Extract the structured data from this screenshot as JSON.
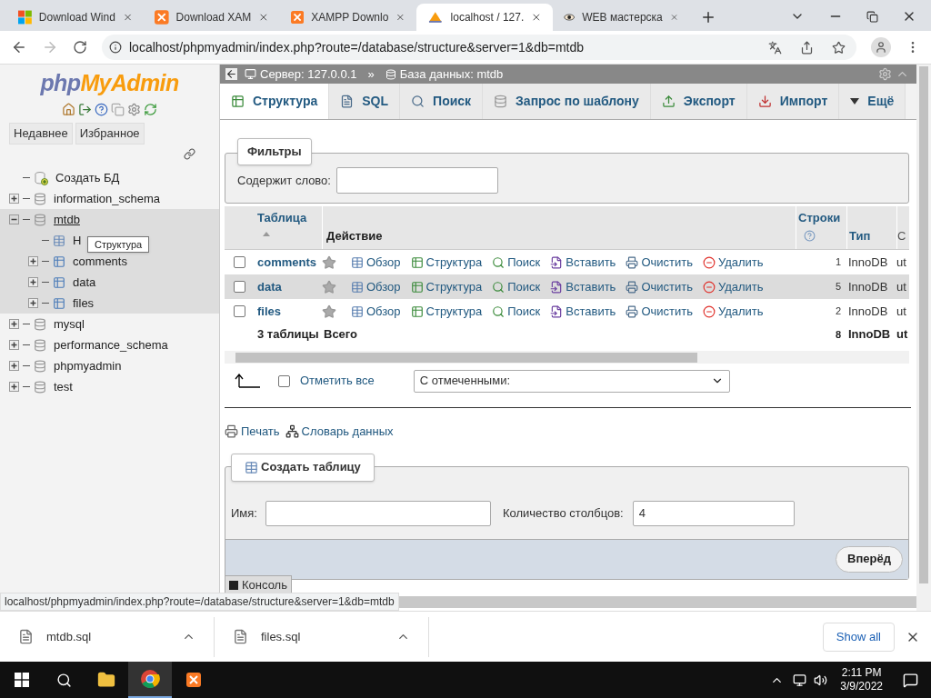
{
  "browser": {
    "tabs": [
      {
        "title": "Download Wind",
        "kind": "windows",
        "selected": false
      },
      {
        "title": "Download XAM",
        "kind": "xampp",
        "selected": false
      },
      {
        "title": "XAMPP Downlo",
        "kind": "xampp",
        "selected": false
      },
      {
        "title": "localhost / 127.",
        "kind": "pma",
        "selected": true
      },
      {
        "title": "WEB мастерска",
        "kind": "eye",
        "selected": false
      }
    ],
    "url": "localhost/phpmyadmin/index.php?route=/database/structure&server=1&db=mtdb"
  },
  "sidebar": {
    "logo": {
      "first": "php",
      "second": "MyAdmin"
    },
    "buttons": [
      "Недавнее",
      "Избранное"
    ],
    "tree": [
      {
        "name": "Создать БД",
        "kind": "new"
      },
      {
        "name": "information_schema",
        "kind": "db",
        "expanded": false,
        "selected": false
      },
      {
        "name": "mtdb",
        "kind": "db",
        "expanded": true,
        "selected": true,
        "children": [
          {
            "name": "Н",
            "kind": "new_table"
          },
          {
            "name": "comments",
            "kind": "table",
            "expanded": false
          },
          {
            "name": "data",
            "kind": "table",
            "expanded": false
          },
          {
            "name": "files",
            "kind": "table",
            "expanded": false
          }
        ]
      },
      {
        "name": "mysql",
        "kind": "db",
        "expanded": false,
        "selected": false
      },
      {
        "name": "performance_schema",
        "kind": "db",
        "expanded": false,
        "selected": false
      },
      {
        "name": "phpmyadmin",
        "kind": "db",
        "expanded": false,
        "selected": false
      },
      {
        "name": "test",
        "kind": "db",
        "expanded": false,
        "selected": false
      }
    ],
    "tooltip": "Структура"
  },
  "breadcrumb": {
    "server": "Сервер: 127.0.0.1",
    "separator": "»",
    "database": "База данных: mtdb"
  },
  "tabs": [
    {
      "label": "Структура",
      "kind": "structure",
      "selected": true
    },
    {
      "label": "SQL",
      "kind": "sql",
      "selected": false
    },
    {
      "label": "Поиск",
      "kind": "search",
      "selected": false
    },
    {
      "label": "Запрос по шаблону",
      "kind": "query",
      "selected": false
    },
    {
      "label": "Экспорт",
      "kind": "export",
      "selected": false
    },
    {
      "label": "Импорт",
      "kind": "import",
      "selected": false
    },
    {
      "label": "Ещё",
      "kind": "more",
      "selected": false
    }
  ],
  "filters": {
    "legend": "Фильтры",
    "label": "Содержит слово:"
  },
  "table": {
    "columns": [
      "Таблица",
      "Действие",
      "Строки",
      "Тип",
      "С"
    ],
    "rows": [
      {
        "name": "comments",
        "checked": false,
        "highlighted": false,
        "rows": "1",
        "type": "InnoDB",
        "collation": "ut",
        "actions": [
          {
            "label": "Обзор",
            "kind": "browse"
          },
          {
            "label": "Структура",
            "kind": "structure"
          },
          {
            "label": "Поиск",
            "kind": "search"
          },
          {
            "label": "Вставить",
            "kind": "insert"
          },
          {
            "label": "Очистить",
            "kind": "empty"
          },
          {
            "label": "Удалить",
            "kind": "drop"
          }
        ]
      },
      {
        "name": "data",
        "checked": false,
        "highlighted": true,
        "rows": "5",
        "type": "InnoDB",
        "collation": "ut",
        "actions": [
          {
            "label": "Обзор",
            "kind": "browse"
          },
          {
            "label": "Структура",
            "kind": "structure"
          },
          {
            "label": "Поиск",
            "kind": "search"
          },
          {
            "label": "Вставить",
            "kind": "insert"
          },
          {
            "label": "Очистить",
            "kind": "empty"
          },
          {
            "label": "Удалить",
            "kind": "drop"
          }
        ]
      },
      {
        "name": "files",
        "checked": false,
        "highlighted": false,
        "rows": "2",
        "type": "InnoDB",
        "collation": "ut",
        "actions": [
          {
            "label": "Обзор",
            "kind": "browse"
          },
          {
            "label": "Структура",
            "kind": "structure"
          },
          {
            "label": "Поиск",
            "kind": "search"
          },
          {
            "label": "Вставить",
            "kind": "insert"
          },
          {
            "label": "Очистить",
            "kind": "empty"
          },
          {
            "label": "Удалить",
            "kind": "drop"
          }
        ]
      }
    ],
    "footer": {
      "count": "3 таблицы",
      "label": "Всего",
      "rows": "8",
      "type": "InnoDB",
      "collation": "ut"
    }
  },
  "check_all": {
    "label": "Отметить все",
    "checked": false,
    "select": "С отмеченными:"
  },
  "links": [
    {
      "label": "Печать",
      "kind": "print"
    },
    {
      "label": "Словарь данных",
      "kind": "dictionary"
    }
  ],
  "create_table": {
    "legend": "Создать таблицу",
    "name_label": "Имя:",
    "columns_label": "Количество столбцов:",
    "columns_value": "4",
    "button": "Вперёд"
  },
  "console": "Консоль",
  "status_url": "localhost/phpmyadmin/index.php?route=/database/structure&server=1&db=mtdb",
  "downloads": {
    "files": [
      "mtdb.sql",
      "files.sql"
    ],
    "show_all": "Show all"
  },
  "taskbar": {
    "apps": [
      {
        "kind": "explorer",
        "selected": false
      },
      {
        "kind": "chrome",
        "selected": true
      },
      {
        "kind": "xampp",
        "selected": false
      }
    ],
    "time": "2:11 PM",
    "date": "3/9/2022"
  }
}
